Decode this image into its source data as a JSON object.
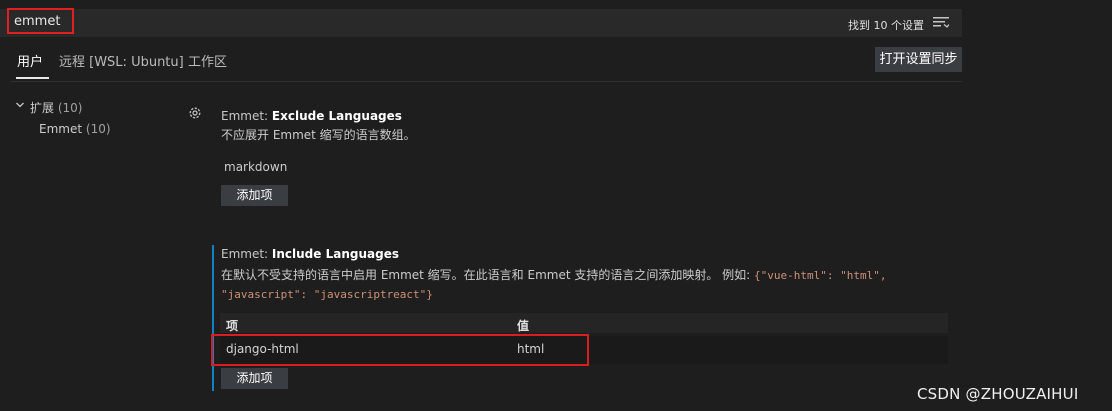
{
  "search": {
    "value": "emmet",
    "result_count": "找到 10 个设置"
  },
  "tabs": [
    {
      "label": "用户",
      "active": true
    },
    {
      "label": "远程 [WSL: Ubuntu]"
    },
    {
      "label": "工作区"
    }
  ],
  "sync_button": "打开设置同步",
  "tree": {
    "root": {
      "label": "扩展",
      "count": "(10)"
    },
    "child": {
      "label": "Emmet",
      "count": "(10)"
    }
  },
  "settings": {
    "exclude": {
      "category": "Emmet: ",
      "name": "Exclude Languages",
      "description": "不应展开 Emmet 缩写的语言数组。",
      "items": [
        "markdown"
      ],
      "add_label": "添加项"
    },
    "include": {
      "category": "Emmet: ",
      "name": "Include Languages",
      "description_line1": "在默认不受支持的语言中启用 Emmet 缩写。在此语言和 Emmet 支持的语言之间添加映射。 例如:",
      "example_part1": "{\"vue-html\": \"html\",",
      "example_part2": "\"javascript\": \"javascriptreact\"}",
      "col_item": "项",
      "col_value": "值",
      "rows": [
        {
          "item": "django-html",
          "value": "html"
        }
      ],
      "add_label": "添加项"
    }
  },
  "watermark": "CSDN @ZHOUZAIHUI",
  "colors": {
    "accent": "#1380c8",
    "highlight_border": "#d81e1e",
    "background": "#1e1e1e"
  }
}
